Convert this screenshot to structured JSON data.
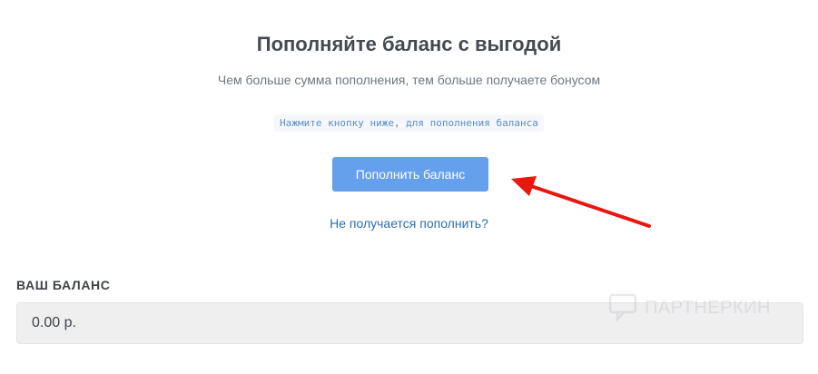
{
  "header": {
    "title": "Пополняйте баланс с выгодой",
    "subtitle": "Чем больше сумма пополнения, тем больше получаете бонусом",
    "hint": "Нажмите кнопку ниже, для пополнения баланса"
  },
  "actions": {
    "topup_label": "Пополнить баланс",
    "help_link": "Не получается пополнить?"
  },
  "balance": {
    "label": "ВАШ БАЛАНС",
    "value": "0.00 р."
  },
  "watermark": {
    "text": "ПАРТНЕРКИН"
  },
  "colors": {
    "button": "#64a0ec",
    "link": "#2a6fb0",
    "arrow": "#e8170f",
    "hint_text": "#5d8fc4"
  },
  "icons": {
    "arrow": "red-arrow-icon",
    "watermark": "chat-bubble-icon"
  }
}
